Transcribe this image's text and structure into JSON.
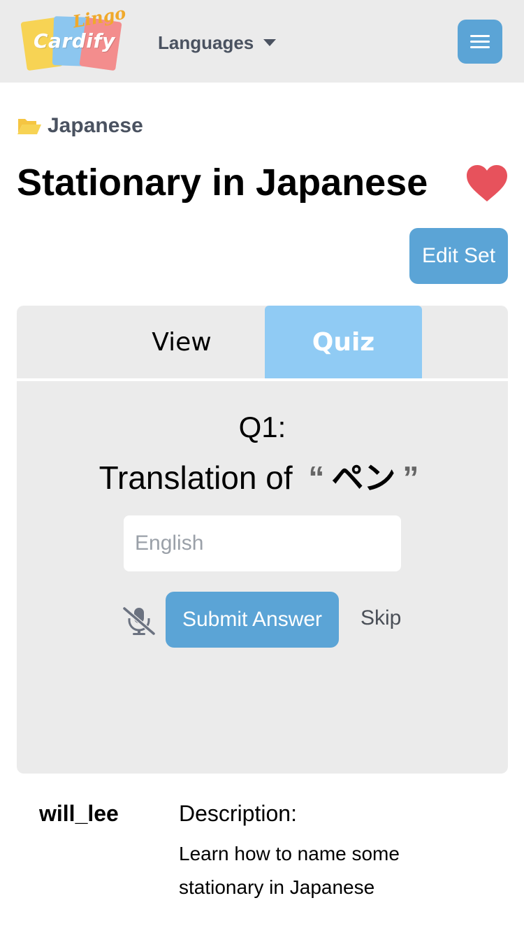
{
  "navbar": {
    "logo": {
      "main": "Cardify",
      "sub": "Lingo"
    },
    "languages_label": "Languages",
    "accent_color": "#5ba4d6"
  },
  "breadcrumb": {
    "icon": "folder-open-icon",
    "label": "Japanese"
  },
  "set": {
    "title": "Stationary in Japanese",
    "favorite": true,
    "edit_label": "Edit Set"
  },
  "tabs": [
    {
      "label": "View",
      "active": false
    },
    {
      "label": "Quiz",
      "active": true
    }
  ],
  "quiz": {
    "question_number": "Q1:",
    "prompt_prefix": "Translation of",
    "open_quote": "“",
    "word": "ペン",
    "close_quote": "”",
    "input_placeholder": "English",
    "input_value": "",
    "mic_icon": "microphone-muted-icon",
    "submit_label": "Submit Answer",
    "skip_label": "Skip"
  },
  "info": {
    "author": "will_lee",
    "description_heading": "Description:",
    "description_text": "Learn how to name some stationary in Japanese"
  }
}
